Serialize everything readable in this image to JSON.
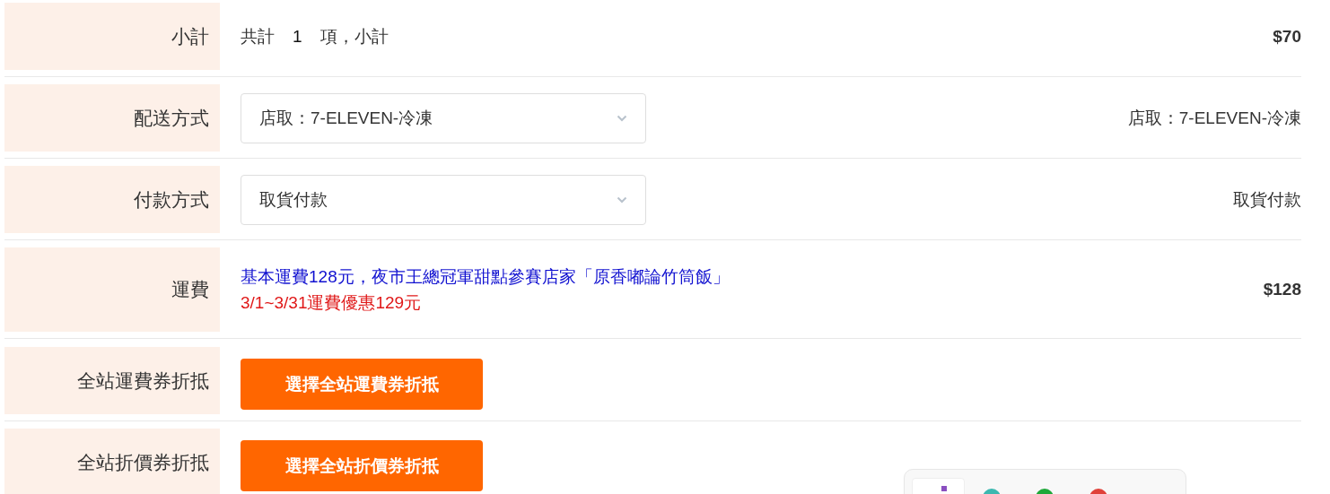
{
  "rows": [
    {
      "kind": "subtotal",
      "label": "小計",
      "prefix": "共計",
      "count": "1",
      "suffix": "項，小計",
      "value": "$70"
    },
    {
      "kind": "select",
      "label": "配送方式",
      "selected_option": "店取：7-ELEVEN-冷凍",
      "value": "店取：7-ELEVEN-冷凍"
    },
    {
      "kind": "select",
      "label": "付款方式",
      "selected_option": "取貨付款",
      "value": "取貨付款"
    },
    {
      "kind": "fee",
      "label": "運費",
      "note": "基本運費128元，夜市王總冠軍甜點參賽店家「原香嘟論竹筒飯」",
      "promo": "3/1~3/31運費優惠129元",
      "value": "$128"
    },
    {
      "kind": "coupon",
      "label": "全站運費券折抵",
      "button": "選擇全站運費券折抵"
    },
    {
      "kind": "coupon",
      "label": "全站折價券折抵",
      "button": "選擇全站折價券折抵"
    }
  ]
}
